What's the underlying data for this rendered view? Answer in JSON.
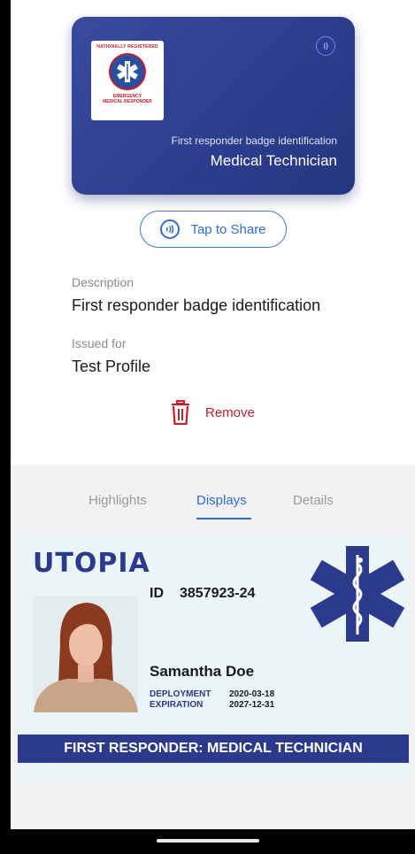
{
  "credential": {
    "logo_top": "NATIONALLY REGISTERED",
    "logo_mid": "EMERGENCY",
    "logo_bottom": "MEDICAL RESPONDER",
    "subtitle": "First responder badge identification",
    "title": "Medical Technician"
  },
  "share_label": "Tap to Share",
  "details": {
    "description_label": "Description",
    "description_value": "First responder badge identification",
    "issued_label": "Issued for",
    "issued_value": "Test Profile"
  },
  "remove_label": "Remove",
  "tabs": [
    {
      "label": "Highlights",
      "active": false
    },
    {
      "label": "Displays",
      "active": true
    },
    {
      "label": "Details",
      "active": false
    }
  ],
  "id_card": {
    "brand": "UTOPIA",
    "id_label": "ID",
    "id_number": "3857923-24",
    "name": "Samantha Doe",
    "deployment_label": "DEPLOYMENT",
    "deployment_date": "2020-03-18",
    "expiration_label": "EXPIRATION",
    "expiration_date": "2027-12-31",
    "banner": "FIRST RESPONDER: MEDICAL TECHNICIAN"
  },
  "colors": {
    "card_blue": "#2c3d8e",
    "accent_blue": "#2e6fd0",
    "remove_red": "#c0202b",
    "id_navy": "#2c3a8c"
  }
}
